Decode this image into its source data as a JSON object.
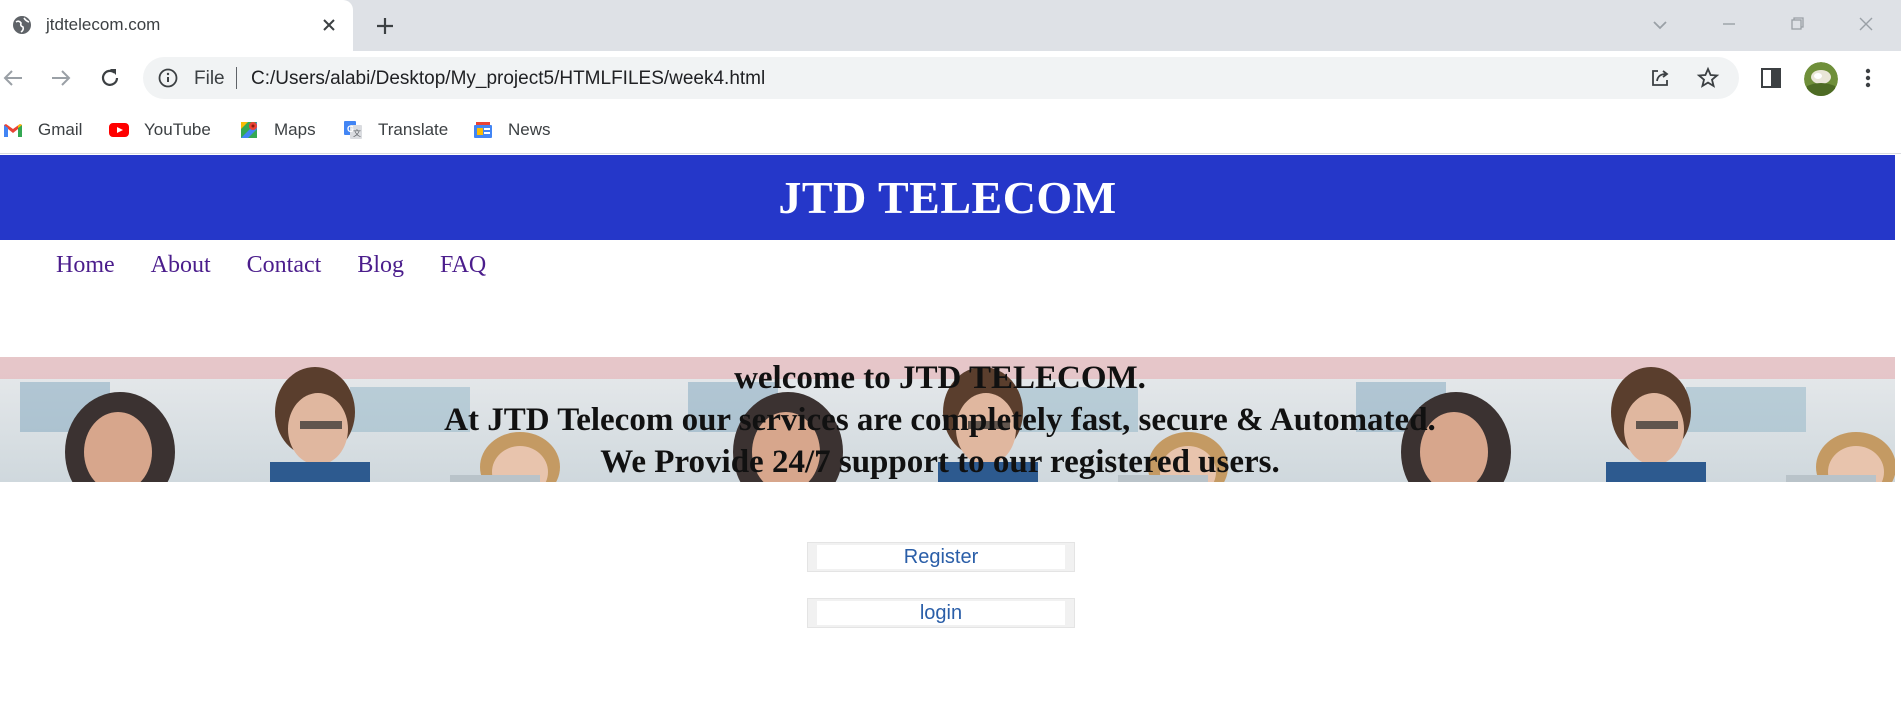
{
  "browser": {
    "tab": {
      "title": "jtdtelecom.com"
    },
    "address_bar": {
      "scheme_label": "File",
      "url": "C:/Users/alabi/Desktop/My_project5/HTMLFILES/week4.html"
    },
    "bookmarks": [
      {
        "label": "Gmail",
        "icon": "gmail-icon"
      },
      {
        "label": "YouTube",
        "icon": "youtube-icon"
      },
      {
        "label": "Maps",
        "icon": "maps-icon"
      },
      {
        "label": "Translate",
        "icon": "translate-icon"
      },
      {
        "label": "News",
        "icon": "news-icon"
      }
    ]
  },
  "page": {
    "header": {
      "title": "JTD TELECOM",
      "background": "#2537c9"
    },
    "nav": [
      "Home",
      "About",
      "Contact",
      "Blog",
      "FAQ"
    ],
    "hero": {
      "lines": [
        "welcome to JTD TELECOM.",
        "At JTD Telecom our services are completely fast, secure & Automated.",
        "We Provide 24/7 support to our registered users."
      ]
    },
    "actions": {
      "register": "Register",
      "login": "login"
    }
  }
}
